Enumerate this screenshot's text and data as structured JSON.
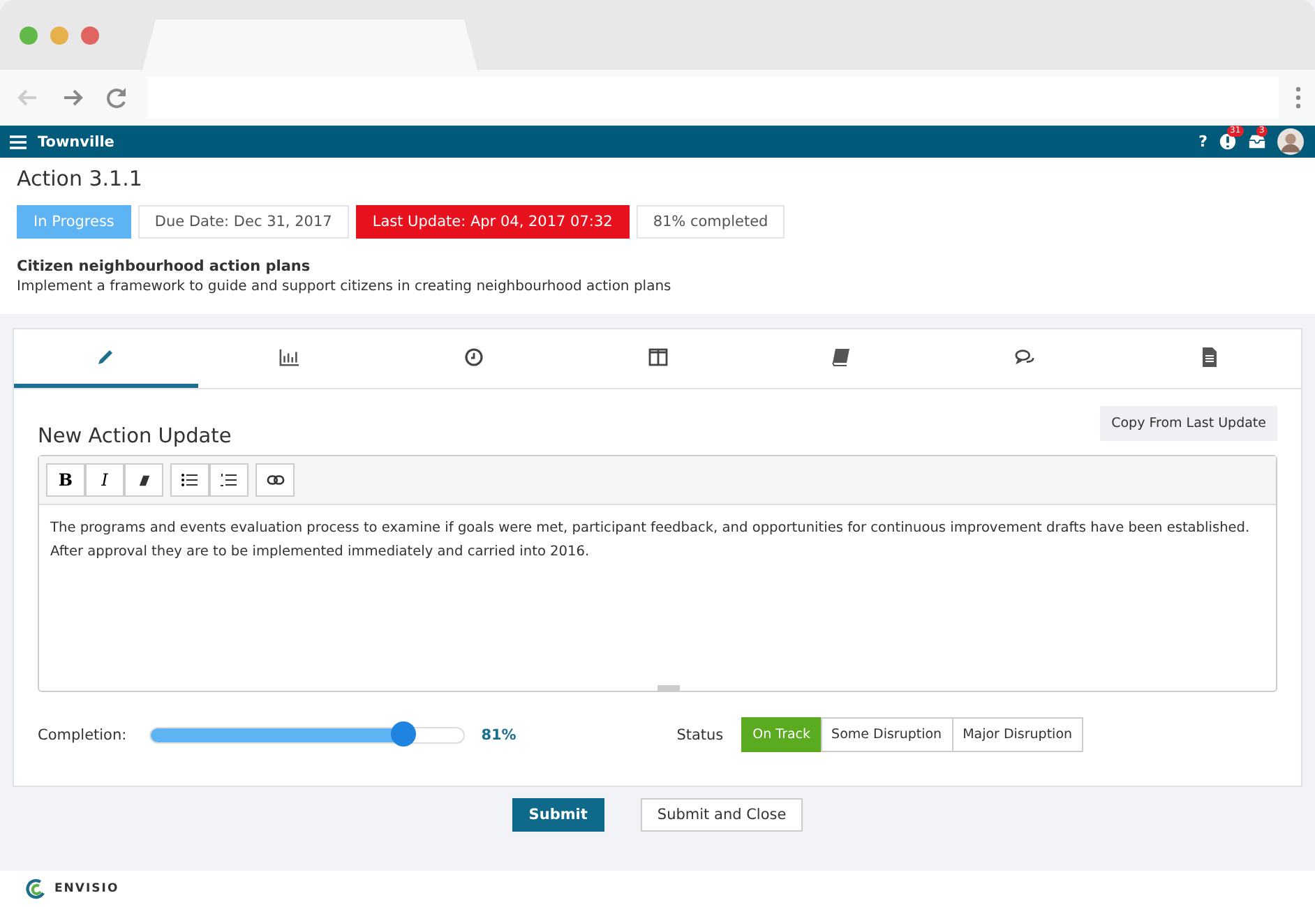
{
  "app_bar": {
    "title": "Townville",
    "help": "?",
    "alerts_badge": "31",
    "messages_badge": "3"
  },
  "action": {
    "title": "Action 3.1.1",
    "tags": [
      {
        "kind": "status",
        "text": "In Progress"
      },
      {
        "kind": "plain",
        "text": "Due Date: Dec 31, 2017"
      },
      {
        "kind": "alert",
        "text": "Last Update: Apr 04, 2017 07:32"
      },
      {
        "kind": "plain",
        "text": "81% completed"
      }
    ],
    "name": "Citizen neighbourhood action plans",
    "description": "Implement a framework to guide and support citizens in creating neighbourhood action plans"
  },
  "tabs": [
    {
      "kind": "pencil",
      "selected": true
    },
    {
      "kind": "chart",
      "selected": false
    },
    {
      "kind": "clock",
      "selected": false
    },
    {
      "kind": "columns",
      "selected": false
    },
    {
      "kind": "book",
      "selected": false
    },
    {
      "kind": "comments",
      "selected": false
    },
    {
      "kind": "document",
      "selected": false
    }
  ],
  "update": {
    "heading": "New Action Update",
    "copy_button": "Copy From Last Update",
    "toolbar": [
      {
        "kind": "bold",
        "text": "B"
      },
      {
        "kind": "italic",
        "text": "I"
      },
      {
        "kind": "eraser"
      },
      {
        "kind": "bullets"
      },
      {
        "kind": "numbers"
      },
      {
        "kind": "link"
      }
    ],
    "text": "The programs and events evaluation process to examine if goals were met, participant feedback, and opportunities for continuous improvement drafts have been established. After approval they are to be implemented immediately and carried into 2016.",
    "completion_label": "Completion:",
    "completion": {
      "level": 0.81
    },
    "completion_reading": "81%",
    "status_label": "Status",
    "status_options": [
      {
        "label": "On Track",
        "selected": true
      },
      {
        "label": "Some Disruption",
        "selected": false
      },
      {
        "label": "Major Disruption",
        "selected": false
      }
    ]
  },
  "buttons": [
    {
      "kind": "primary",
      "label": "Submit"
    },
    {
      "kind": "secondary",
      "label": "Submit and Close"
    }
  ],
  "footer": {
    "brand": "ENVISIO"
  }
}
